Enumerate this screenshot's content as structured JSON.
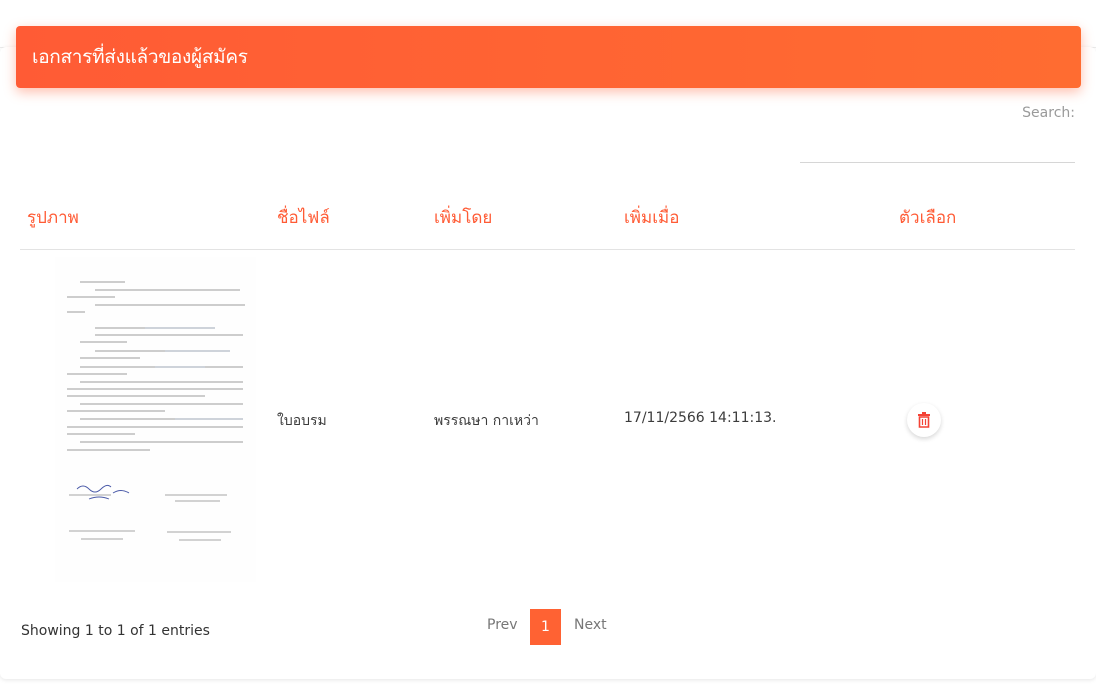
{
  "card": {
    "title": "เอกสารที่ส่งแล้วของผู้สมัคร"
  },
  "search": {
    "label": "Search:",
    "value": ""
  },
  "table": {
    "headers": [
      "รูปภาพ",
      "ชื่อไฟล์",
      "เพิ่มโดย",
      "เพิ่มเมื่อ",
      "ตัวเลือก"
    ],
    "rows": [
      {
        "filename": "ใบอบรม",
        "added_by": "พรรณษา กาเหว่า",
        "added_at": "17/11/2566 14:11:13.",
        "action_icon": "trash-icon"
      }
    ]
  },
  "footer": {
    "info": "Showing 1 to 1 of 1 entries",
    "prev": "Prev",
    "page": "1",
    "next": "Next"
  },
  "colors": {
    "accent": "#ff5b35",
    "delete": "#f44336"
  }
}
